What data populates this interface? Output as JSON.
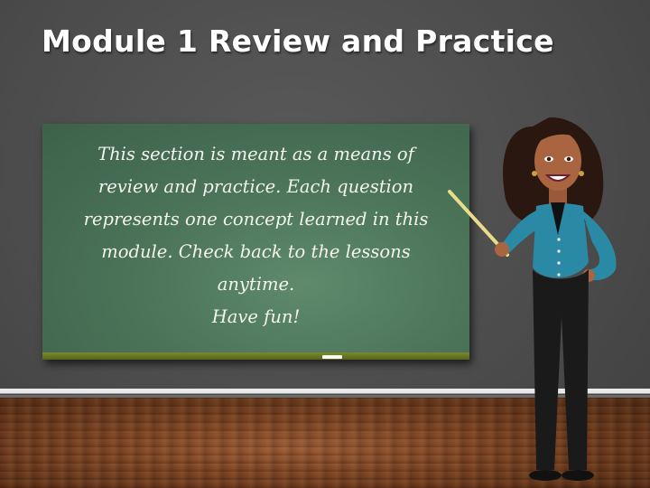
{
  "slide": {
    "title": "Module 1 Review and Practice",
    "board_lines": [
      "This section is meant as a means of",
      "review and practice. Each question",
      "represents one concept learned in this",
      "module. Check back to the lessons",
      "anytime.",
      "Have fun!"
    ]
  },
  "colors": {
    "background": "#4c4c4c",
    "chalkboard": "#4b7459",
    "board_ledge": "#7b8a2f",
    "floor": "#7a4222",
    "title_text": "#ffffff"
  },
  "icons": {
    "teacher": "teacher-illustration-icon",
    "pointer": "pointer-stick-icon"
  }
}
